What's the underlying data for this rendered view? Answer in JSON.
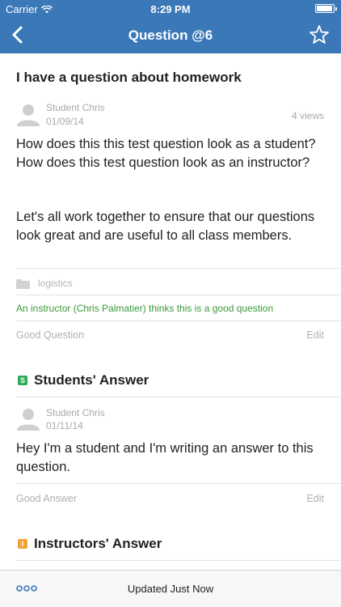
{
  "status_bar": {
    "carrier": "Carrier",
    "time": "8:29 PM"
  },
  "nav": {
    "title": "Question @6",
    "back_icon": "chevron-left-icon",
    "star_icon": "star-outline-icon"
  },
  "question": {
    "title": "I have a question about homework",
    "author": "Student Chris",
    "date": "01/09/14",
    "views": "4 views",
    "paragraph_1": "How does this this test question look as a student? How does this test question look as an instructor?",
    "paragraph_2": "Let's all work together to ensure that our questions look great and are useful to all class members.",
    "folder": "logistics",
    "endorsement": "An instructor (Chris Palmatier) thinks this is a good question",
    "good_label": "Good Question",
    "edit_label": "Edit"
  },
  "students_answer": {
    "badge": "S",
    "heading": "Students' Answer",
    "author": "Student Chris",
    "date": "01/11/14",
    "text": "Hey I'm a student and I'm writing an answer to this question.",
    "good_label": "Good Answer",
    "edit_label": "Edit"
  },
  "instructors_answer": {
    "badge": "I",
    "heading": "Instructors' Answer"
  },
  "toolbar": {
    "status": "Updated Just Now",
    "more_icon": "more-dots-icon"
  },
  "colors": {
    "nav_bg": "#3a78b8",
    "endorse": "#3a9a3a",
    "student_badge": "#2eaa56",
    "instructor_badge": "#f0a43a"
  }
}
